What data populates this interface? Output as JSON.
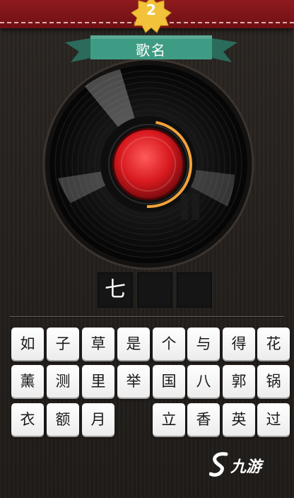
{
  "header": {
    "level": "2"
  },
  "banner": {
    "label": "歌名"
  },
  "player": {
    "state": "paused"
  },
  "answer": {
    "slots": [
      "七",
      "",
      ""
    ]
  },
  "keyboard": {
    "rows": [
      [
        "如",
        "子",
        "草",
        "是",
        "个",
        "与",
        "得",
        "花"
      ],
      [
        "薰",
        "测",
        "里",
        "举",
        "国",
        "八",
        "郭",
        "锅"
      ],
      [
        "衣",
        "额",
        "月",
        "",
        "立",
        "香",
        "英",
        "过"
      ]
    ]
  },
  "watermark": {
    "text": "九游"
  },
  "colors": {
    "header_red": "#8e1a1e",
    "ribbon_teal": "#3f9c84",
    "badge_yellow": "#f2c23a",
    "button_red": "#d7191e",
    "progress_orange": "#f2a23a"
  }
}
